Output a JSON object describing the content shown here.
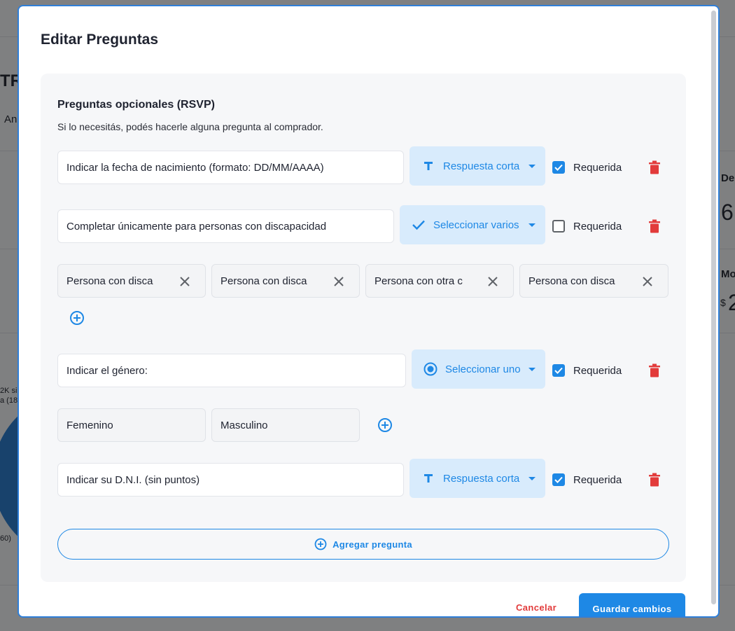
{
  "background": {
    "fragments": [
      "TR",
      "An",
      "De",
      "6",
      "Mo",
      "$",
      "2",
      "2K sin",
      "a (18/",
      "60)"
    ]
  },
  "modal": {
    "title": "Editar Preguntas",
    "section": {
      "title": "Preguntas opcionales (RSVP)",
      "subtitle": "Si lo necesitás, podés hacerle alguna pregunta al comprador."
    },
    "questions": [
      {
        "text": "Indicar la fecha de nacimiento (formato: DD/MM/AAAA)",
        "type_icon": "text-t-icon",
        "type_label": "Respuesta corta",
        "required_label": "Requerida",
        "required": true
      },
      {
        "text": "Completar únicamente para personas con discapacidad",
        "type_icon": "check-icon",
        "type_label": "Seleccionar varios",
        "required_label": "Requerida",
        "required": false,
        "options": [
          "Persona con disca",
          "Persona con disca",
          "Persona con otra c",
          "Persona con disca"
        ]
      },
      {
        "text": "Indicar el género:",
        "type_icon": "radio-icon",
        "type_label": "Seleccionar uno",
        "required_label": "Requerida",
        "required": true,
        "options": [
          "Femenino",
          "Masculino"
        ]
      },
      {
        "text": "Indicar su D.N.I. (sin puntos)",
        "type_icon": "text-t-icon",
        "type_label": "Respuesta corta",
        "required_label": "Requerida",
        "required": true
      }
    ],
    "add_question_label": "Agregar pregunta",
    "cancel_label": "Cancelar",
    "save_label": "Guardar cambios"
  },
  "colors": {
    "accent": "#1e88e5",
    "select_bg": "#d8ebfc",
    "danger": "#e23b3b",
    "card_bg": "#f6f7f9"
  }
}
